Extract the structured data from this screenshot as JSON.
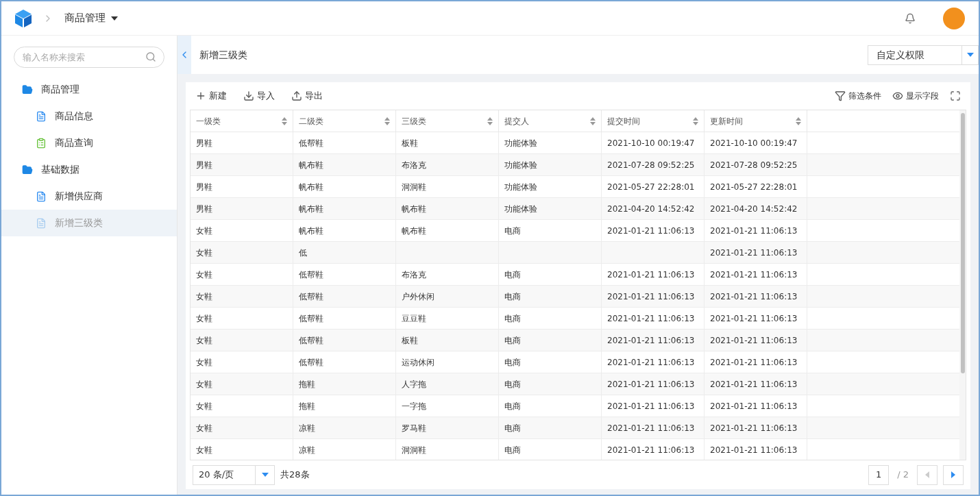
{
  "header": {
    "breadcrumb": "商品管理"
  },
  "sidebar": {
    "search": {
      "placeholder": "输入名称来搜索"
    },
    "items": [
      {
        "label": "商品管理",
        "kind": "folder",
        "selected": false,
        "children": [
          {
            "label": "商品信息",
            "kind": "doc",
            "selected": false
          },
          {
            "label": "商品查询",
            "kind": "clipboard",
            "selected": false
          }
        ]
      },
      {
        "label": "基础数据",
        "kind": "folder",
        "selected": false,
        "children": [
          {
            "label": "新增供应商",
            "kind": "doc",
            "selected": false
          },
          {
            "label": "新增三级类",
            "kind": "doc",
            "selected": true
          }
        ]
      }
    ]
  },
  "page": {
    "title": "新增三级类",
    "permission_select": "自定义权限"
  },
  "toolbar": {
    "left": [
      {
        "label": "新建",
        "kind": "plus"
      },
      {
        "label": "导入",
        "kind": "import"
      },
      {
        "label": "导出",
        "kind": "export"
      }
    ],
    "right": [
      {
        "label": "筛选条件",
        "kind": "filter"
      },
      {
        "label": "显示字段",
        "kind": "eye"
      }
    ]
  },
  "table": {
    "columns": [
      "一级类",
      "二级类",
      "三级类",
      "提交人",
      "提交时间",
      "更新时间"
    ],
    "rows": [
      {
        "col_1": "男鞋",
        "col_2": "低帮鞋",
        "col_3": "板鞋",
        "col_4": "功能体验",
        "col_5": "2021-10-10 00:19:47",
        "col_6": "2021-10-10 00:19:47"
      },
      {
        "col_1": "男鞋",
        "col_2": "帆布鞋",
        "col_3": "布洛克",
        "col_4": "功能体验",
        "col_5": "2021-07-28 09:52:25",
        "col_6": "2021-07-28 09:52:25"
      },
      {
        "col_1": "男鞋",
        "col_2": "帆布鞋",
        "col_3": "洞洞鞋",
        "col_4": "功能体验",
        "col_5": "2021-05-27 22:28:01",
        "col_6": "2021-05-27 22:28:01"
      },
      {
        "col_1": "男鞋",
        "col_2": "帆布鞋",
        "col_3": "帆布鞋",
        "col_4": "功能体验",
        "col_5": "2021-04-20 14:52:42",
        "col_6": "2021-04-20 14:52:42"
      },
      {
        "col_1": "女鞋",
        "col_2": "帆布鞋",
        "col_3": "帆布鞋",
        "col_4": "电商",
        "col_5": "2021-01-21 11:06:13",
        "col_6": "2021-01-21 11:06:13"
      },
      {
        "col_1": "女鞋",
        "col_2": "低",
        "col_6": "2021-01-21 11:06:13"
      },
      {
        "col_1": "女鞋",
        "col_2": "低帮鞋",
        "col_3": "布洛克",
        "col_4": "电商",
        "col_5": "2021-01-21 11:06:13",
        "col_6": "2021-01-21 11:06:13"
      },
      {
        "col_1": "女鞋",
        "col_2": "低帮鞋",
        "col_3": "户外休闲",
        "col_4": "电商",
        "col_5": "2021-01-21 11:06:13",
        "col_6": "2021-01-21 11:06:13"
      },
      {
        "col_1": "女鞋",
        "col_2": "低帮鞋",
        "col_3": "豆豆鞋",
        "col_4": "电商",
        "col_5": "2021-01-21 11:06:13",
        "col_6": "2021-01-21 11:06:13"
      },
      {
        "col_1": "女鞋",
        "col_2": "低帮鞋",
        "col_3": "板鞋",
        "col_4": "电商",
        "col_5": "2021-01-21 11:06:13",
        "col_6": "2021-01-21 11:06:13"
      },
      {
        "col_1": "女鞋",
        "col_2": "低帮鞋",
        "col_3": "运动休闲",
        "col_4": "电商",
        "col_5": "2021-01-21 11:06:13",
        "col_6": "2021-01-21 11:06:13"
      },
      {
        "col_1": "女鞋",
        "col_2": "拖鞋",
        "col_3": "人字拖",
        "col_4": "电商",
        "col_5": "2021-01-21 11:06:13",
        "col_6": "2021-01-21 11:06:13"
      },
      {
        "col_1": "女鞋",
        "col_2": "拖鞋",
        "col_3": "一字拖",
        "col_4": "电商",
        "col_5": "2021-01-21 11:06:13",
        "col_6": "2021-01-21 11:06:13"
      },
      {
        "col_1": "女鞋",
        "col_2": "凉鞋",
        "col_3": "罗马鞋",
        "col_4": "电商",
        "col_5": "2021-01-21 11:06:13",
        "col_6": "2021-01-21 11:06:13"
      },
      {
        "col_1": "女鞋",
        "col_2": "凉鞋",
        "col_3": "洞洞鞋",
        "col_4": "电商",
        "col_5": "2021-01-21 11:06:13",
        "col_6": "2021-01-21 11:06:13"
      }
    ]
  },
  "pagination": {
    "page_size": "20 条/页",
    "total": "共28条",
    "current_page": "1",
    "page_count": "/ 2"
  }
}
